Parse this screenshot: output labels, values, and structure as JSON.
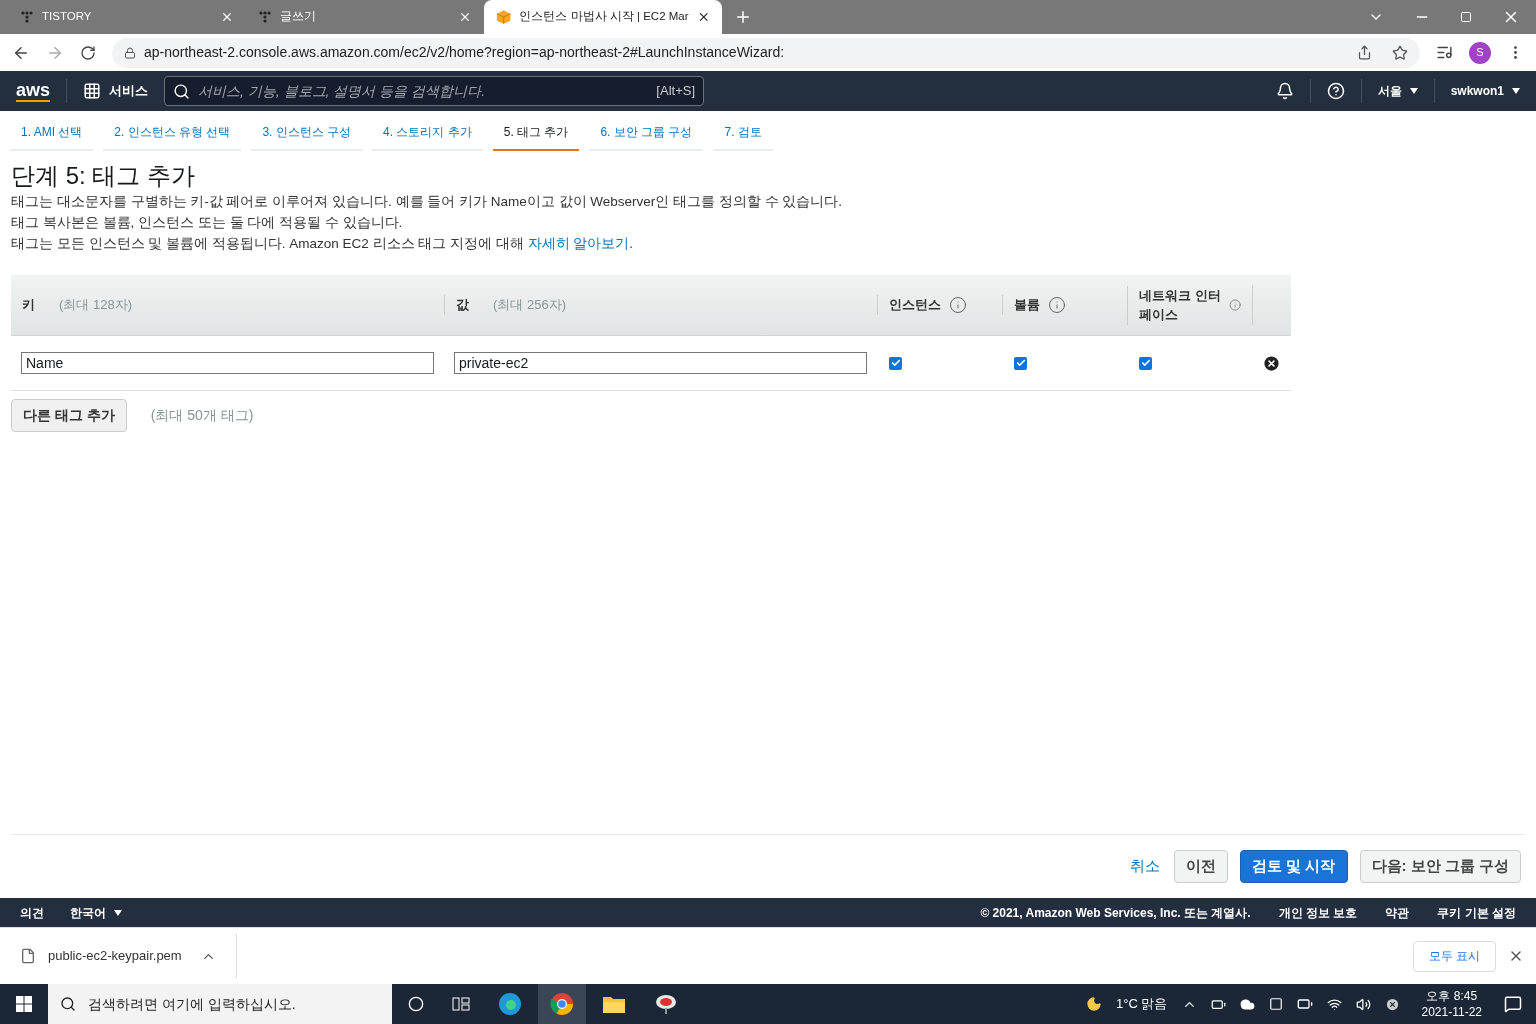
{
  "browser": {
    "tabs": [
      {
        "title": "TISTORY",
        "kind": "dots",
        "selected": false
      },
      {
        "title": "글쓰기",
        "kind": "dots",
        "selected": false
      },
      {
        "title": "인스턴스 마법사 시작 | EC2 Mar",
        "kind": "box",
        "selected": true
      }
    ],
    "url": "ap-northeast-2.console.aws.amazon.com/ec2/v2/home?region=ap-northeast-2#LaunchInstanceWizard:",
    "profile": "S"
  },
  "aws_nav": {
    "logo": "aws",
    "services": "서비스",
    "search_placeholder": "서비스, 기능, 블로그, 설명서 등을 검색합니다.",
    "shortcut": "[Alt+S]",
    "region": "서울",
    "user": "swkwon1"
  },
  "steps": [
    {
      "label": "1. AMI 선택",
      "selected": false
    },
    {
      "label": "2. 인스턴스 유형 선택",
      "selected": false
    },
    {
      "label": "3. 인스턴스 구성",
      "selected": false
    },
    {
      "label": "4. 스토리지 추가",
      "selected": false
    },
    {
      "label": "5. 태그 추가",
      "selected": true
    },
    {
      "label": "6. 보안 그룹 구성",
      "selected": false
    },
    {
      "label": "7. 검토",
      "selected": false
    }
  ],
  "page": {
    "title": "단계 5: 태그 추가",
    "lines": [
      {
        "text": "태그는 대소문자를 구별하는 키-값 페어로 이루어져 있습니다. 예를 들어 키가 Name이고 값이 Webserver인 태그를 정의할 수 있습니다."
      },
      {
        "text": "태그 복사본은 볼륨, 인스턴스 또는 둘 다에 적용될 수 있습니다."
      },
      {
        "text": "태그는 모든 인스턴스 및 볼륨에 적용됩니다. Amazon EC2 리소스 태그 지정에 대해",
        "link": "자세히 알아보기",
        "after": "."
      }
    ]
  },
  "table": {
    "columns": [
      {
        "label": "키",
        "hint": "(최대 128자)",
        "info": false
      },
      {
        "label": "값",
        "hint": "(최대 256자)",
        "info": false
      },
      {
        "label": "인스턴스",
        "info": true
      },
      {
        "label": "볼륨",
        "info": true
      },
      {
        "label": "네트워크 인터페이스",
        "info": true
      }
    ],
    "rows": [
      {
        "key": "Name",
        "value": "private-ec2",
        "instances": true,
        "volumes": true,
        "network": true
      }
    ],
    "add_button": "다른 태그 추가",
    "add_hint": "(최대 50개 태그)"
  },
  "actions": {
    "cancel": "취소",
    "buttons": [
      {
        "label": "이전",
        "kind": "secondary"
      },
      {
        "label": "검토 및 시작",
        "kind": "primary"
      },
      {
        "label": "다음: 보안 그룹 구성",
        "kind": "secondary"
      }
    ]
  },
  "footer": {
    "feedback": "의견",
    "language": "한국어",
    "copyright": "© 2021, Amazon Web Services, Inc. 또는 계열사.",
    "links": [
      "개인 정보 보호",
      "약관",
      "쿠키 기본 설정"
    ]
  },
  "downloads": {
    "file": "public-ec2-keypair.pem",
    "show_all": "모두 표시"
  },
  "taskbar": {
    "search_placeholder": "검색하려면 여기에 입력하십시오.",
    "weather": "1°C 맑음",
    "time": "오후 8:45",
    "date": "2021-11-22"
  }
}
